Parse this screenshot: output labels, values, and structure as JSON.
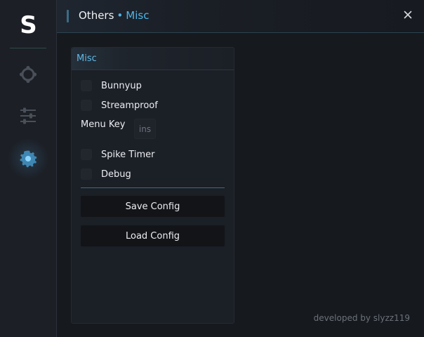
{
  "app": {
    "logo_letter": "S"
  },
  "sidebar": {
    "items": [
      {
        "icon": "crosshair-icon",
        "active": false
      },
      {
        "icon": "sliders-icon",
        "active": false
      },
      {
        "icon": "gear-icon",
        "active": true
      }
    ]
  },
  "header": {
    "section": "Others",
    "separator": "•",
    "subsection": "Misc",
    "close_icon": "close-icon"
  },
  "panel": {
    "title": "Misc",
    "options": [
      {
        "label": "Bunnyup",
        "checked": false
      },
      {
        "label": "Streamproof",
        "checked": false
      }
    ],
    "menu_key": {
      "label": "Menu Key",
      "value": "ins"
    },
    "options2": [
      {
        "label": "Spike Timer",
        "checked": false
      },
      {
        "label": "Debug",
        "checked": false
      }
    ],
    "save_label": "Save Config",
    "load_label": "Load Config"
  },
  "footer": {
    "credit": "developed by slyzz119"
  },
  "colors": {
    "accent": "#4fb6e8",
    "background": "#16191e",
    "sidebar": "#1c1f25",
    "panel": "#1b1f26",
    "button": "#121418"
  }
}
